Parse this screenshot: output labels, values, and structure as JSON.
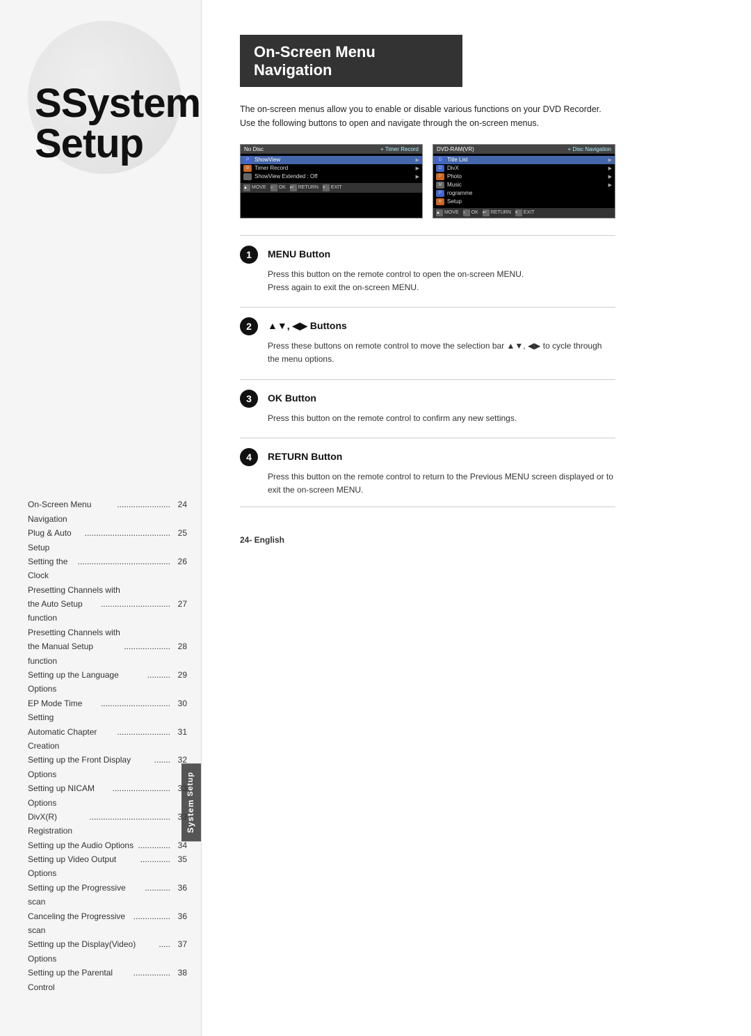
{
  "left": {
    "title_system": "System",
    "title_setup": "Setup",
    "sidebar_tab_normal": "System Setup",
    "sidebar_tab_bold": "System",
    "toc_items": [
      {
        "label": "On-Screen Menu Navigation",
        "dots": ".......................",
        "page": "24"
      },
      {
        "label": "Plug & Auto Setup",
        "dots": ".....................................",
        "page": "25"
      },
      {
        "label": "Setting the Clock",
        "dots": "........................................",
        "page": "26"
      },
      {
        "label": "Presetting Channels with",
        "dots": "",
        "page": ""
      },
      {
        "label": "the Auto Setup function",
        "dots": "..............................",
        "page": "27"
      },
      {
        "label": "Presetting Channels with",
        "dots": "",
        "page": ""
      },
      {
        "label": "the Manual Setup function ",
        "dots": "....................",
        "page": "28"
      },
      {
        "label": "Setting up the Language Options ",
        "dots": "..........",
        "page": "29"
      },
      {
        "label": "EP Mode Time Setting ",
        "dots": "..............................",
        "page": "30"
      },
      {
        "label": "Automatic Chapter Creation",
        "dots": ".......................",
        "page": "31"
      },
      {
        "label": "Setting up the Front Display Options",
        "dots": ".......",
        "page": "32"
      },
      {
        "label": "Setting up NICAM Options",
        "dots": ".........................",
        "page": "33"
      },
      {
        "label": "DivX(R) Registration",
        "dots": "...................................",
        "page": "33"
      },
      {
        "label": "Setting up the Audio Options ",
        "dots": "..............",
        "page": "34"
      },
      {
        "label": "Setting up Video Output Options",
        "dots": ".............",
        "page": "35"
      },
      {
        "label": "Setting up the Progressive scan ",
        "dots": "...........",
        "page": "36"
      },
      {
        "label": "Canceling the Progressive scan",
        "dots": "................",
        "page": "36"
      },
      {
        "label": "Setting up the Display(Video) Options",
        "dots": ".....",
        "page": "37"
      },
      {
        "label": "Setting up the Parental Control",
        "dots": "................",
        "page": "38"
      }
    ]
  },
  "right": {
    "section_title_line1": "On-Screen Menu",
    "section_title_line2": "Navigation",
    "intro_p1": "The on-screen menus allow you to enable or disable various functions on your DVD Recorder.",
    "intro_p2": "Use the following buttons to open and navigate through the on-screen menus.",
    "screen_left": {
      "header_left": "No Disc",
      "header_right": "+ Timer Record",
      "rows": [
        {
          "icon": "prog",
          "label": "ShowView",
          "arrow": "▶",
          "selected": true
        },
        {
          "icon": "gear",
          "label": "Timer Record",
          "arrow": "▶",
          "selected": false
        },
        {
          "icon": "",
          "label": "ShowView Extended : Off",
          "arrow": "▶",
          "selected": false
        }
      ],
      "footer": [
        "MOVE",
        "OK",
        "RETURN",
        "EXIT"
      ]
    },
    "screen_right": {
      "header_left": "DVD-RAM(VR)",
      "header_right": "+ Disc Navigation",
      "rows": [
        {
          "icon": "disc",
          "label": "Title List",
          "arrow": "▶",
          "selected": true
        },
        {
          "icon": "disc",
          "label": "DivX",
          "arrow": "▶",
          "selected": false
        },
        {
          "icon": "disc",
          "label": "Photo",
          "arrow": "▶",
          "selected": false
        },
        {
          "icon": "disc",
          "label": "Music",
          "arrow": "▶",
          "selected": false
        },
        {
          "icon": "prog",
          "label": "rogramme",
          "arrow": "",
          "selected": false
        },
        {
          "icon": "gear",
          "label": "Setup",
          "arrow": "",
          "selected": false
        }
      ],
      "footer": [
        "MOVE",
        "OK",
        "RETURN",
        "EXIT"
      ]
    },
    "steps": [
      {
        "number": "1",
        "title": "MENU Button",
        "body": "Press this button on the remote control to open the on-screen MENU.\nPress again to exit the on-screen MENU."
      },
      {
        "number": "2",
        "title": "▲▼, ◀▶ Buttons",
        "body": "Press these buttons on remote control to move the selection bar ▲▼, ◀▶ to cycle through the menu options."
      },
      {
        "number": "3",
        "title": "OK Button",
        "body": "Press this button on the remote control to confirm any new settings."
      },
      {
        "number": "4",
        "title": "RETURN Button",
        "body": "Press this button on the remote control to return to the Previous MENU screen displayed or to exit the on-screen MENU."
      }
    ],
    "footer_text": "24- English"
  }
}
